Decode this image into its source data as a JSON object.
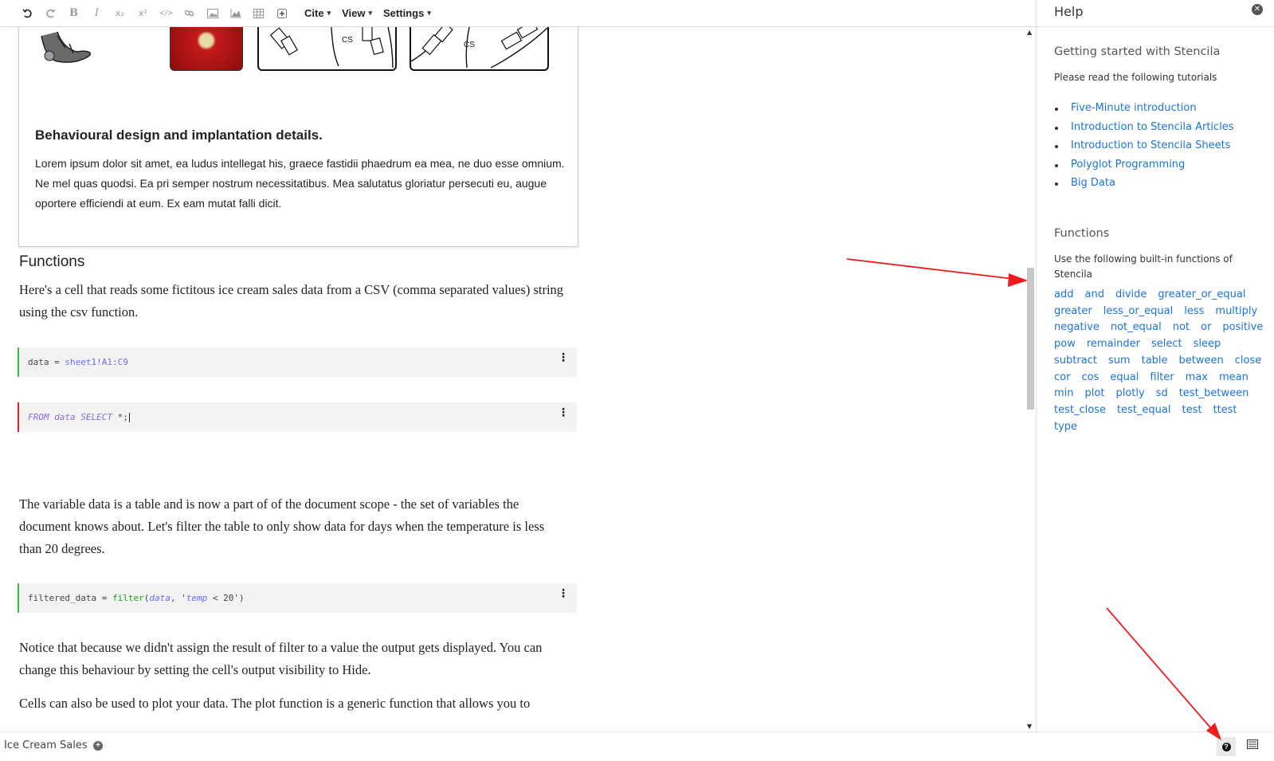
{
  "toolbar": {
    "icons": [
      "undo-icon",
      "redo-icon",
      "bold-icon",
      "italic-icon",
      "subscript-icon",
      "superscript-icon",
      "code-icon",
      "link-icon",
      "image-icon",
      "chart-icon",
      "table-icon",
      "insert-cell-icon"
    ],
    "bold_glyph": "B",
    "italic_glyph": "I",
    "subscript_glyph": "x₂",
    "superscript_glyph": "x²",
    "code_glyph": "</>",
    "cite_label": "Cite",
    "view_label": "View",
    "settings_label": "Settings"
  },
  "document": {
    "figure": {
      "cs_label_1": "CS",
      "cs_label_2": "CS",
      "title": "Behavioural design and implantation details.",
      "caption": "Lorem ipsum dolor sit amet, ea ludus intellegat his, graece fastidii phaedrum ea mea, ne duo esse omnium. Ne mel quas quodsi. Ea pri semper nostrum necessitatibus. Mea salutatus gloriatur persecuti eu, augue oportere efficiendi at eum. Ex eam mutat falli dicit."
    },
    "section_heading": "Functions",
    "para1": "Here's a cell that reads some fictitous ice cream sales data from a CSV (comma separated values) string using the csv function.",
    "cell1": {
      "var": "data",
      "op": " = ",
      "ref": "sheet1!A1:C9"
    },
    "cell2": {
      "kw1": "FROM",
      "word": "data",
      "kw2": "SELECT",
      "rest": " *;"
    },
    "para2": "The variable data is a table and is now a part of of the document scope - the set of variables the document knows about. Let's filter the table to only show data for days when the temperature is less than 20 degrees.",
    "cell3": {
      "var": "filtered_data",
      "op": " = ",
      "fn": "filter",
      "open": "(",
      "arg": "data",
      "sep": ", '",
      "arg2": "temp",
      "rest": " < 20')"
    },
    "para3": "Notice that because we didn't assign the result of filter to a value the output gets displayed. You can change this behaviour by setting the cell's output visibility to Hide.",
    "para4": "Cells can also be used to plot your data. The plot function is a generic function that allows you to",
    "cell_menu_glyph": "⋮"
  },
  "help": {
    "title": "Help",
    "getting_started_heading": "Getting started with Stencila",
    "getting_started_desc": "Please read the following tutorials",
    "tutorials": [
      "Five-Minute introduction",
      "Introduction to Stencila Articles",
      "Introduction to Stencila Sheets",
      "Polyglot Programming",
      "Big Data"
    ],
    "functions_heading": "Functions",
    "functions_desc": "Use the following built-in functions of Stencila",
    "functions": [
      "add",
      "and",
      "divide",
      "greater_or_equal",
      "greater",
      "less_or_equal",
      "less",
      "multiply",
      "negative",
      "not_equal",
      "not",
      "or",
      "positive",
      "pow",
      "remainder",
      "select",
      "sleep",
      "subtract",
      "sum",
      "table",
      "between",
      "close",
      "cor",
      "cos",
      "equal",
      "filter",
      "max",
      "mean",
      "min",
      "plot",
      "plotly",
      "sd",
      "test_between",
      "test_close",
      "test_equal",
      "test",
      "ttest",
      "type"
    ]
  },
  "statusbar": {
    "tab_label": "Ice Cream Sales",
    "add_glyph": "+",
    "help_glyph": "?"
  },
  "colors": {
    "link": "#1a73d9",
    "cell_ok": "#3cbf3c",
    "cell_error": "#e02020",
    "arrow": "#ee1c1c"
  }
}
